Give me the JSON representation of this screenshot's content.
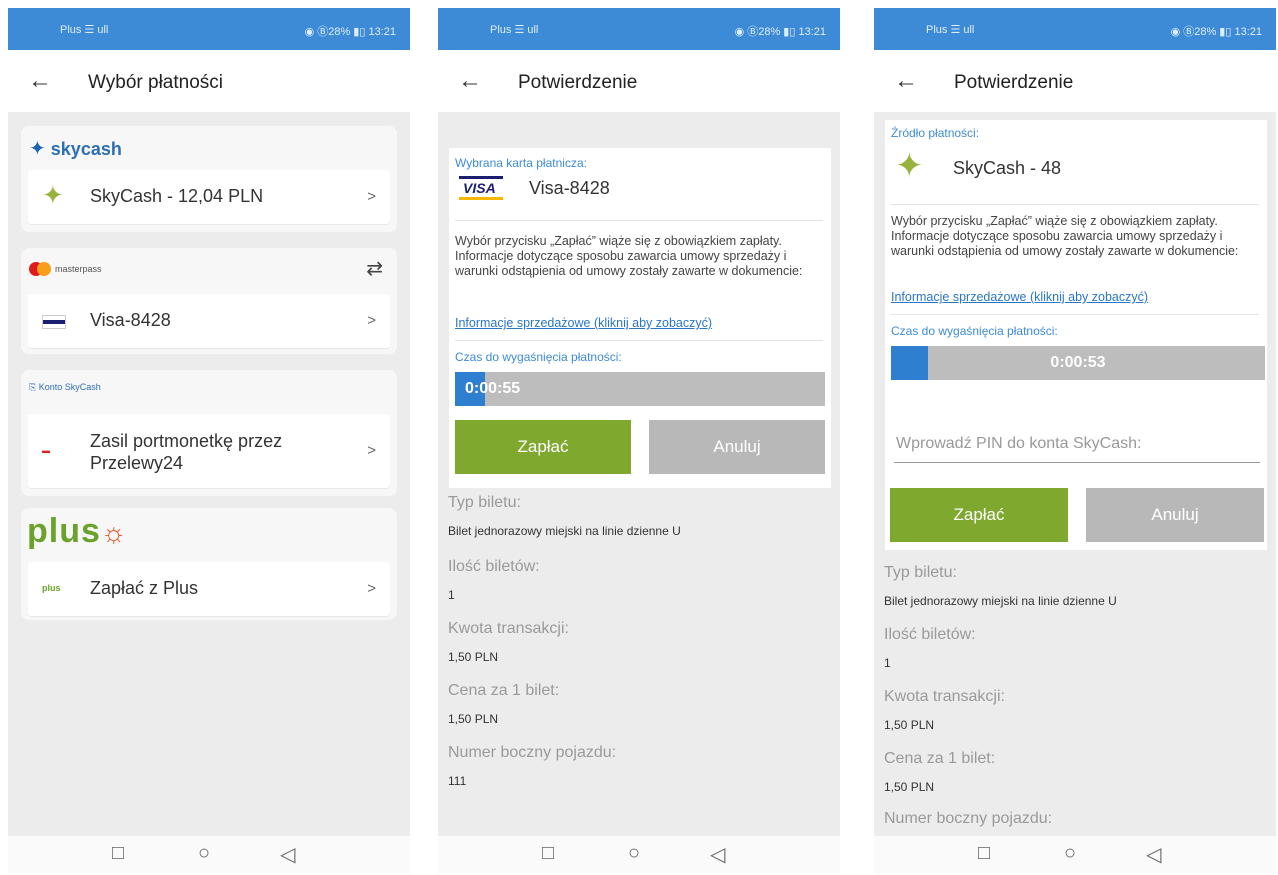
{
  "status": {
    "left": "Plus ☰ ull",
    "right": "◉ Ⓑ28% ▮▯ 13:21"
  },
  "nav": {
    "square": "□",
    "circle": "○",
    "triangle": "◁"
  },
  "screen1": {
    "title": "Wybór płatności",
    "skycash_logo": "skycash",
    "skycash_row": "SkyCash - 12,04 PLN",
    "masterpass_logo": "masterpass",
    "visa_row": "Visa-8428",
    "konto_logo": "Konto SkyCash",
    "przelewy_row": "Zasil portmonetkę przez Przelewy24",
    "plus_logo": "plus",
    "plus_row": "Zapłać z Plus",
    "chevron": ">"
  },
  "screen2": {
    "title": "Potwierdzenie",
    "card_caption": "Wybrana karta płatnicza:",
    "card_name": "Visa-8428",
    "info": "Wybór przycisku „Zapłać” wiąże się z obowiązkiem zapłaty. Informacje dotyczące sposobu zawarcia umowy sprzedaży i warunki odstąpienia od umowy zostały zawarte w dokumencie:",
    "link": "Informacje sprzedażowe (kliknij aby zobaczyć)",
    "timer_caption": "Czas do wygaśnięcia płatności:",
    "timer": "0:00:55",
    "progress": 0.08,
    "pay": "Zapłać",
    "cancel": "Anuluj",
    "details": [
      {
        "k": "Typ biletu:",
        "v": "Bilet jednorazowy miejski na linie dzienne U"
      },
      {
        "k": "Ilość biletów:",
        "v": "1"
      },
      {
        "k": "Kwota transakcji:",
        "v": "1,50 PLN"
      },
      {
        "k": "Cena za 1 bilet:",
        "v": "1,50 PLN"
      },
      {
        "k": "Numer boczny pojazdu:",
        "v": "111"
      }
    ]
  },
  "screen3": {
    "title": "Potwierdzenie",
    "source_caption": "Źródło płatności:",
    "source_name": "SkyCash - 48",
    "info": "Wybór przycisku „Zapłać” wiąże się z obowiązkiem zapłaty. Informacje dotyczące sposobu zawarcia umowy sprzedaży i warunki odstąpienia od umowy zostały zawarte w dokumencie:",
    "link": "Informacje sprzedażowe (kliknij aby zobaczyć)",
    "timer_caption": "Czas do wygaśnięcia płatności:",
    "timer": "0:00:53",
    "progress": 0.1,
    "pin_placeholder": "Wprowadź PIN do konta SkyCash:",
    "pay": "Zapłać",
    "cancel": "Anuluj",
    "details": [
      {
        "k": "Typ biletu:",
        "v": "Bilet jednorazowy miejski na linie dzienne U"
      },
      {
        "k": "Ilość biletów:",
        "v": "1"
      },
      {
        "k": "Kwota transakcji:",
        "v": "1,50 PLN"
      },
      {
        "k": "Cena za 1 bilet:",
        "v": "1,50 PLN"
      },
      {
        "k": "Numer boczny pojazdu:",
        "v": ""
      }
    ]
  },
  "colors": {
    "statusbar": "#3d8bd6",
    "pay": "#7fa82f",
    "cancel": "#b8b8b8",
    "accent": "#3d8bd6"
  }
}
